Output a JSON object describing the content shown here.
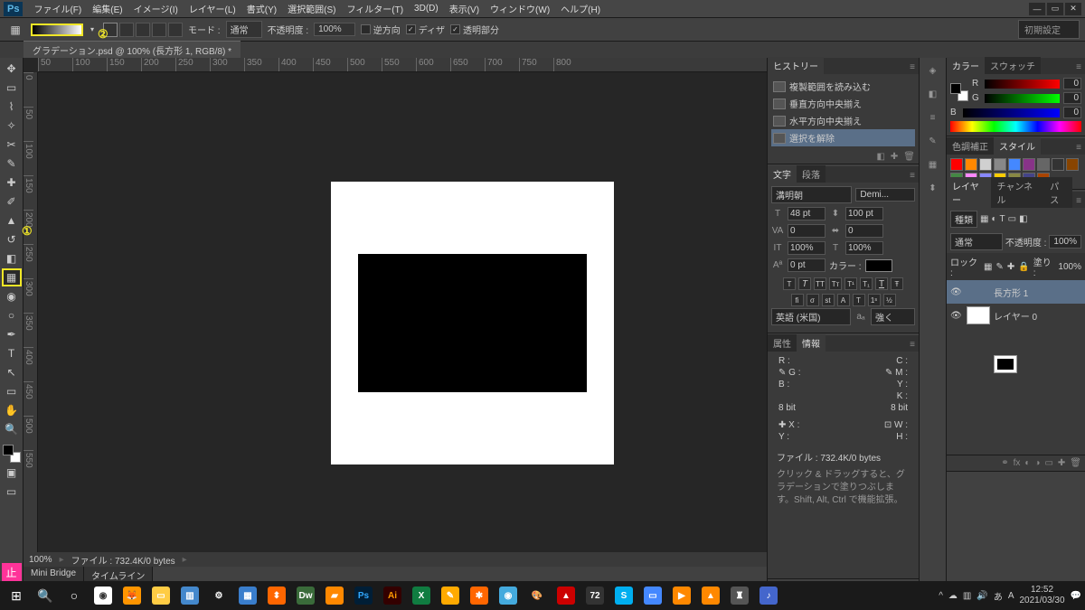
{
  "menu": {
    "items": [
      "ファイル(F)",
      "編集(E)",
      "イメージ(I)",
      "レイヤー(L)",
      "書式(Y)",
      "選択範囲(S)",
      "フィルター(T)",
      "3D(D)",
      "表示(V)",
      "ウィンドウ(W)",
      "ヘルプ(H)"
    ]
  },
  "optbar": {
    "mode_label": "モード :",
    "mode_value": "通常",
    "opacity_label": "不透明度 :",
    "opacity_value": "100%",
    "reverse": "逆方向",
    "dither": "ディザ",
    "transparent": "透明部分"
  },
  "workspace": {
    "label": "初期設定"
  },
  "doc": {
    "tab": "グラデーション.psd @ 100% (長方形 1, RGB/8) *"
  },
  "annotations": {
    "one": "①",
    "two": "②"
  },
  "ruler_h": [
    "50",
    "100",
    "150",
    "200",
    "250",
    "300",
    "350",
    "400",
    "450",
    "500",
    "550",
    "600",
    "650",
    "700",
    "750",
    "800"
  ],
  "ruler_v": [
    "0",
    "50",
    "100",
    "150",
    "200",
    "250",
    "300",
    "350",
    "400",
    "450",
    "500",
    "550"
  ],
  "status": {
    "zoom": "100%",
    "file": "ファイル : 732.4K/0 bytes"
  },
  "bottom_tabs": [
    "Mini Bridge",
    "タイムライン"
  ],
  "history": {
    "title": "ヒストリー",
    "items": [
      "複製範囲を読み込む",
      "垂直方向中央揃え",
      "水平方向中央揃え",
      "選択を解除"
    ]
  },
  "char": {
    "tabs": [
      "文字",
      "段落"
    ],
    "font": "溝明朝",
    "weight": "Demi...",
    "size": "48 pt",
    "leading": "100 pt",
    "tracking": "0",
    "va": "0",
    "vscale": "100%",
    "hscale": "100%",
    "baseline": "0 pt",
    "color_label": "カラー :",
    "lang": "英語 (米国)",
    "aa": "強く"
  },
  "info": {
    "tabs": [
      "属性",
      "情報"
    ],
    "r": "R :",
    "g": "G :",
    "b": "B :",
    "c": "C :",
    "m": "M :",
    "y": "Y :",
    "k": "K :",
    "bit1": "8 bit",
    "bit2": "8 bit",
    "x": "X :",
    "y2": "Y :",
    "w": "W :",
    "h": "H :",
    "file": "ファイル : 732.4K/0 bytes",
    "hint": "クリック & ドラッグすると、グラデーションで塗りつぶします。Shift, Alt, Ctrl で機能拡張。"
  },
  "color": {
    "tabs": [
      "カラー",
      "スウォッチ"
    ],
    "r": "R",
    "g": "G",
    "b": "B",
    "rv": "0",
    "gv": "0",
    "bv": "0"
  },
  "styles": {
    "tabs": [
      "色調補正",
      "スタイル"
    ],
    "colors": [
      "#ff0000",
      "#ff8800",
      "#d0d0d0",
      "#888888",
      "#4488ff",
      "#883388",
      "#666666",
      "#333333",
      "#884400",
      "#448844",
      "#ff88ff",
      "#8888ff",
      "#ffcc00",
      "#888844",
      "#444488",
      "#aa4400"
    ]
  },
  "layers": {
    "tabs": [
      "レイヤー",
      "チャンネル",
      "パス"
    ],
    "kind": "種類",
    "blend": "通常",
    "opacity_label": "不透明度 :",
    "opacity": "100%",
    "lock": "ロック :",
    "fill_label": "塗り :",
    "fill": "100%",
    "items": [
      {
        "name": "長方形 1"
      },
      {
        "name": "レイヤー 0"
      }
    ]
  },
  "taskbar": {
    "time": "12:52",
    "date": "2021/03/30"
  }
}
